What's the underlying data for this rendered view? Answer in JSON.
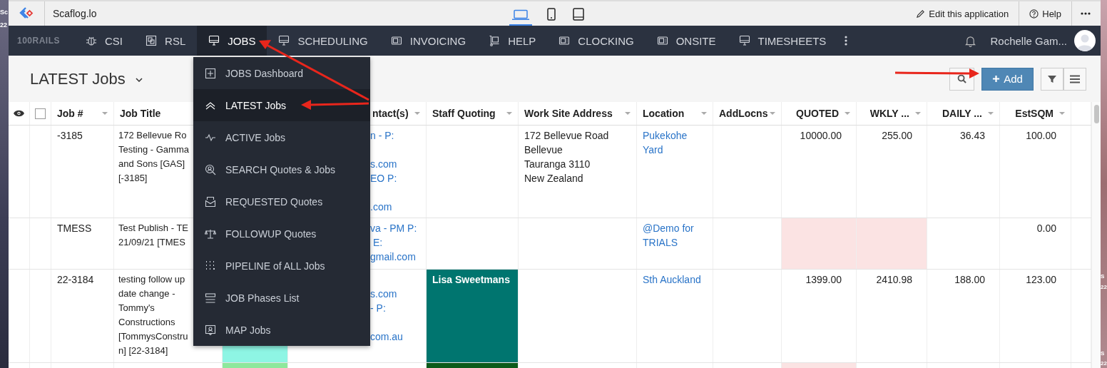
{
  "desktop": {
    "left_labels": [
      "Sc",
      "22"
    ],
    "right_labels": [
      "S",
      "22",
      "S",
      "22"
    ]
  },
  "topbar": {
    "app_name": "Scaflog.lo",
    "devices": [
      {
        "selected": true
      },
      {
        "selected": false
      },
      {
        "selected": false
      }
    ],
    "edit_link": "Edit this application",
    "help": "Help"
  },
  "nav": {
    "logo": "100RAILS",
    "items": [
      {
        "label": "CSI",
        "selected": false
      },
      {
        "label": "RSL",
        "selected": false
      },
      {
        "label": "JOBS",
        "selected": true
      },
      {
        "label": "SCHEDULING",
        "selected": false
      },
      {
        "label": "INVOICING",
        "selected": false
      },
      {
        "label": "HELP",
        "selected": false
      },
      {
        "label": "CLOCKING",
        "selected": false
      },
      {
        "label": "ONSITE",
        "selected": false
      },
      {
        "label": "TIMESHEETS",
        "selected": false
      }
    ],
    "user": "Rochelle Gam..."
  },
  "page": {
    "title": "LATEST Jobs",
    "add_button": "Add"
  },
  "menu": [
    {
      "label": "JOBS Dashboard",
      "selected": false
    },
    {
      "label": "LATEST Jobs",
      "selected": true
    },
    {
      "label": "ACTIVE Jobs",
      "selected": false
    },
    {
      "label": "SEARCH Quotes & Jobs",
      "selected": false
    },
    {
      "label": "REQUESTED Quotes",
      "selected": false
    },
    {
      "label": "FOLLOWUP Quotes",
      "selected": false
    },
    {
      "label": "PIPELINE of ALL Jobs",
      "selected": false
    },
    {
      "label": "JOB Phases List",
      "selected": false
    },
    {
      "label": "MAP Jobs",
      "selected": false
    }
  ],
  "table": {
    "select_all_checked": false,
    "columns": [
      "Job #",
      "Job Title",
      "ntact(s)",
      "Staff Quoting",
      "Work Site Address",
      "Location",
      "AddLocns",
      "QUOTED",
      "WKLY ...",
      "DAILY ...",
      "EstSQM"
    ],
    "rows": [
      {
        "job_no": "-3185",
        "title": "172 Bellevue Ro\nTesting - Gamma\nand Sons [GAS]\n[-3185]",
        "contacts": "n - P:\n\ns.com\nEO P:\n\n.com",
        "address": "172 Bellevue Road\nBellevue\nTauranga 3110\nNew Zealand",
        "location": "Pukekohe\nYard",
        "quoted": {
          "text": "10000.00",
          "flagged": false
        },
        "wkly": {
          "text": "255.00",
          "flagged": false
        },
        "daily": {
          "text": "36.43",
          "flagged": false
        },
        "estsqm": {
          "text": "100.00",
          "flagged": false
        }
      },
      {
        "job_no": "TMESS",
        "title": "Test Publish - TE\n21/09/21 [TMES",
        "contacts": "va - PM P:\n E:\ngmail.com",
        "location": "@Demo for\nTRIALS",
        "quoted": {
          "flagged": true
        },
        "wkly": {
          "flagged": true
        },
        "daily": {
          "flagged": false
        },
        "estsqm": {
          "text": "0.00",
          "flagged": false
        }
      },
      {
        "job_no": "22-3184",
        "title": "testing follow up\ndate change -\nTommy's\nConstructions\n[TommysConstru\nn] [22-3184]",
        "status_cell": {
          "color": "#8ef5e4"
        },
        "contacts": "\ns.com\n- P:\n\ncom.au",
        "staff": {
          "text": "Lisa Sweetmans",
          "color": "#00756f"
        },
        "location": "Sth Auckland",
        "quoted": {
          "text": "1399.00",
          "flagged": false
        },
        "wkly": {
          "text": "2410.98",
          "flagged": false
        },
        "daily": {
          "text": "188.00",
          "flagged": false
        },
        "estsqm": {
          "text": "123.00",
          "flagged": false
        }
      },
      {
        "status_cell": {
          "color": "#8ee89c"
        },
        "staff": {
          "color": "#0b5a1a"
        },
        "quoted": {
          "flagged": true
        },
        "wkly": {
          "flagged": false
        },
        "daily": {
          "flagged": false
        },
        "estsqm": {
          "flagged": false
        }
      }
    ]
  }
}
